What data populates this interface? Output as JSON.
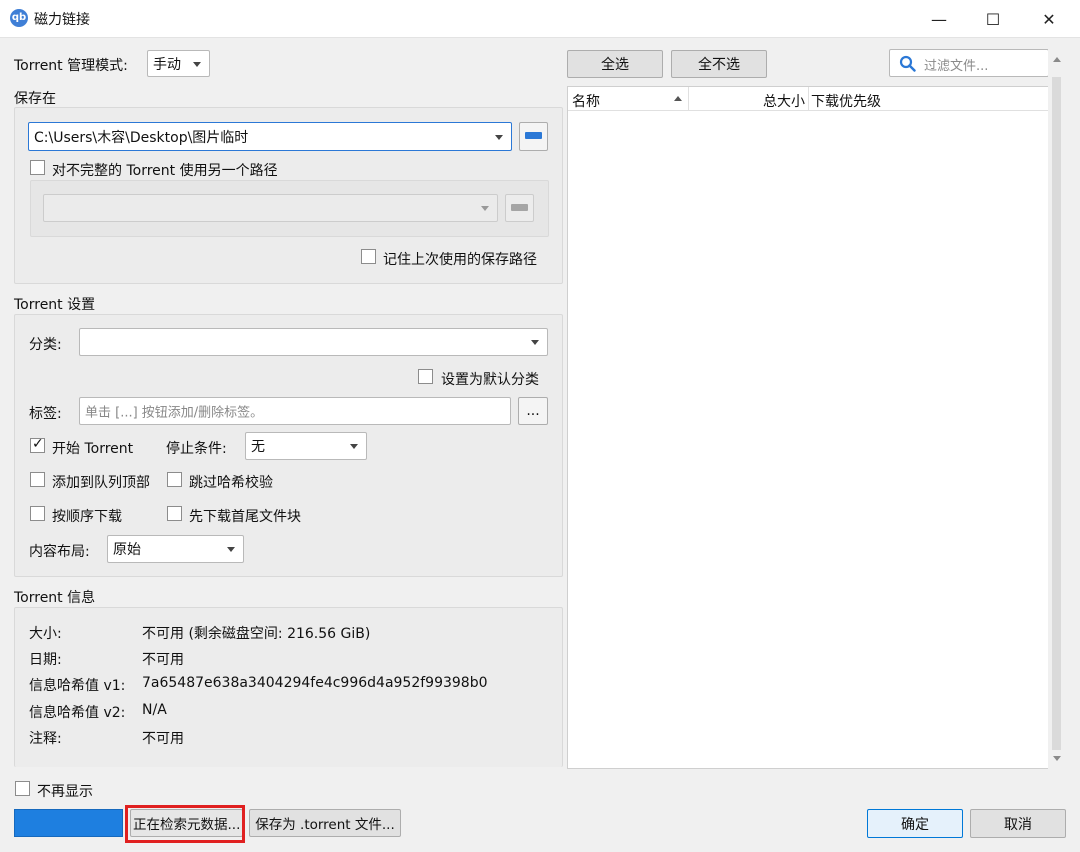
{
  "window": {
    "title": "磁力链接",
    "minimize_glyph": "—",
    "maximize_glyph": "☐",
    "close_glyph": "✕"
  },
  "torrent_mode": {
    "label": "Torrent 管理模式:",
    "value": "手动"
  },
  "save_in": {
    "heading": "保存在",
    "path": "C:\\Users\\木容\\Desktop\\图片临时",
    "alt_path_checkbox": "对不完整的 Torrent 使用另一个路径",
    "alt_path_checked": false,
    "remember_checkbox": "记住上次使用的保存路径",
    "remember_checked": false
  },
  "settings": {
    "heading": "Torrent 设置",
    "category_label": "分类:",
    "category_value": "",
    "default_category_checkbox": "设置为默认分类",
    "tags_label": "标签:",
    "tags_placeholder": "单击 [...] 按钮添加/删除标签。",
    "tags_button": "...",
    "start_torrent": "开始 Torrent",
    "start_checked": true,
    "stop_condition_label": "停止条件:",
    "stop_condition_value": "无",
    "add_to_top": "添加到队列顶部",
    "skip_hash": "跳过哈希校验",
    "sequential": "按顺序下载",
    "first_last": "先下载首尾文件块",
    "layout_label": "内容布局:",
    "layout_value": "原始"
  },
  "info": {
    "heading": "Torrent 信息",
    "rows": [
      {
        "k": "大小:",
        "v": "不可用 (剩余磁盘空间: 216.56 GiB)"
      },
      {
        "k": "日期:",
        "v": "不可用"
      },
      {
        "k": "信息哈希值 v1:",
        "v": "7a65487e638a3404294fe4c996d4a952f99398b0"
      },
      {
        "k": "信息哈希值 v2:",
        "v": "N/A"
      },
      {
        "k": "注释:",
        "v": "不可用"
      }
    ]
  },
  "files": {
    "select_all": "全选",
    "select_none": "全不选",
    "filter_placeholder": "过滤文件...",
    "col_name": "名称",
    "col_size": "总大小",
    "col_priority": "下载优先级"
  },
  "bottom": {
    "dont_show": "不再显示",
    "dont_show_checked": false,
    "retrieving": "正在检索元数据...",
    "save_torrent": "保存为 .torrent 文件...",
    "ok": "确定",
    "cancel": "取消"
  },
  "colors": {
    "accent": "#2b78d6",
    "highlight_box": "#e02020",
    "progress": "#1e7fe0"
  }
}
